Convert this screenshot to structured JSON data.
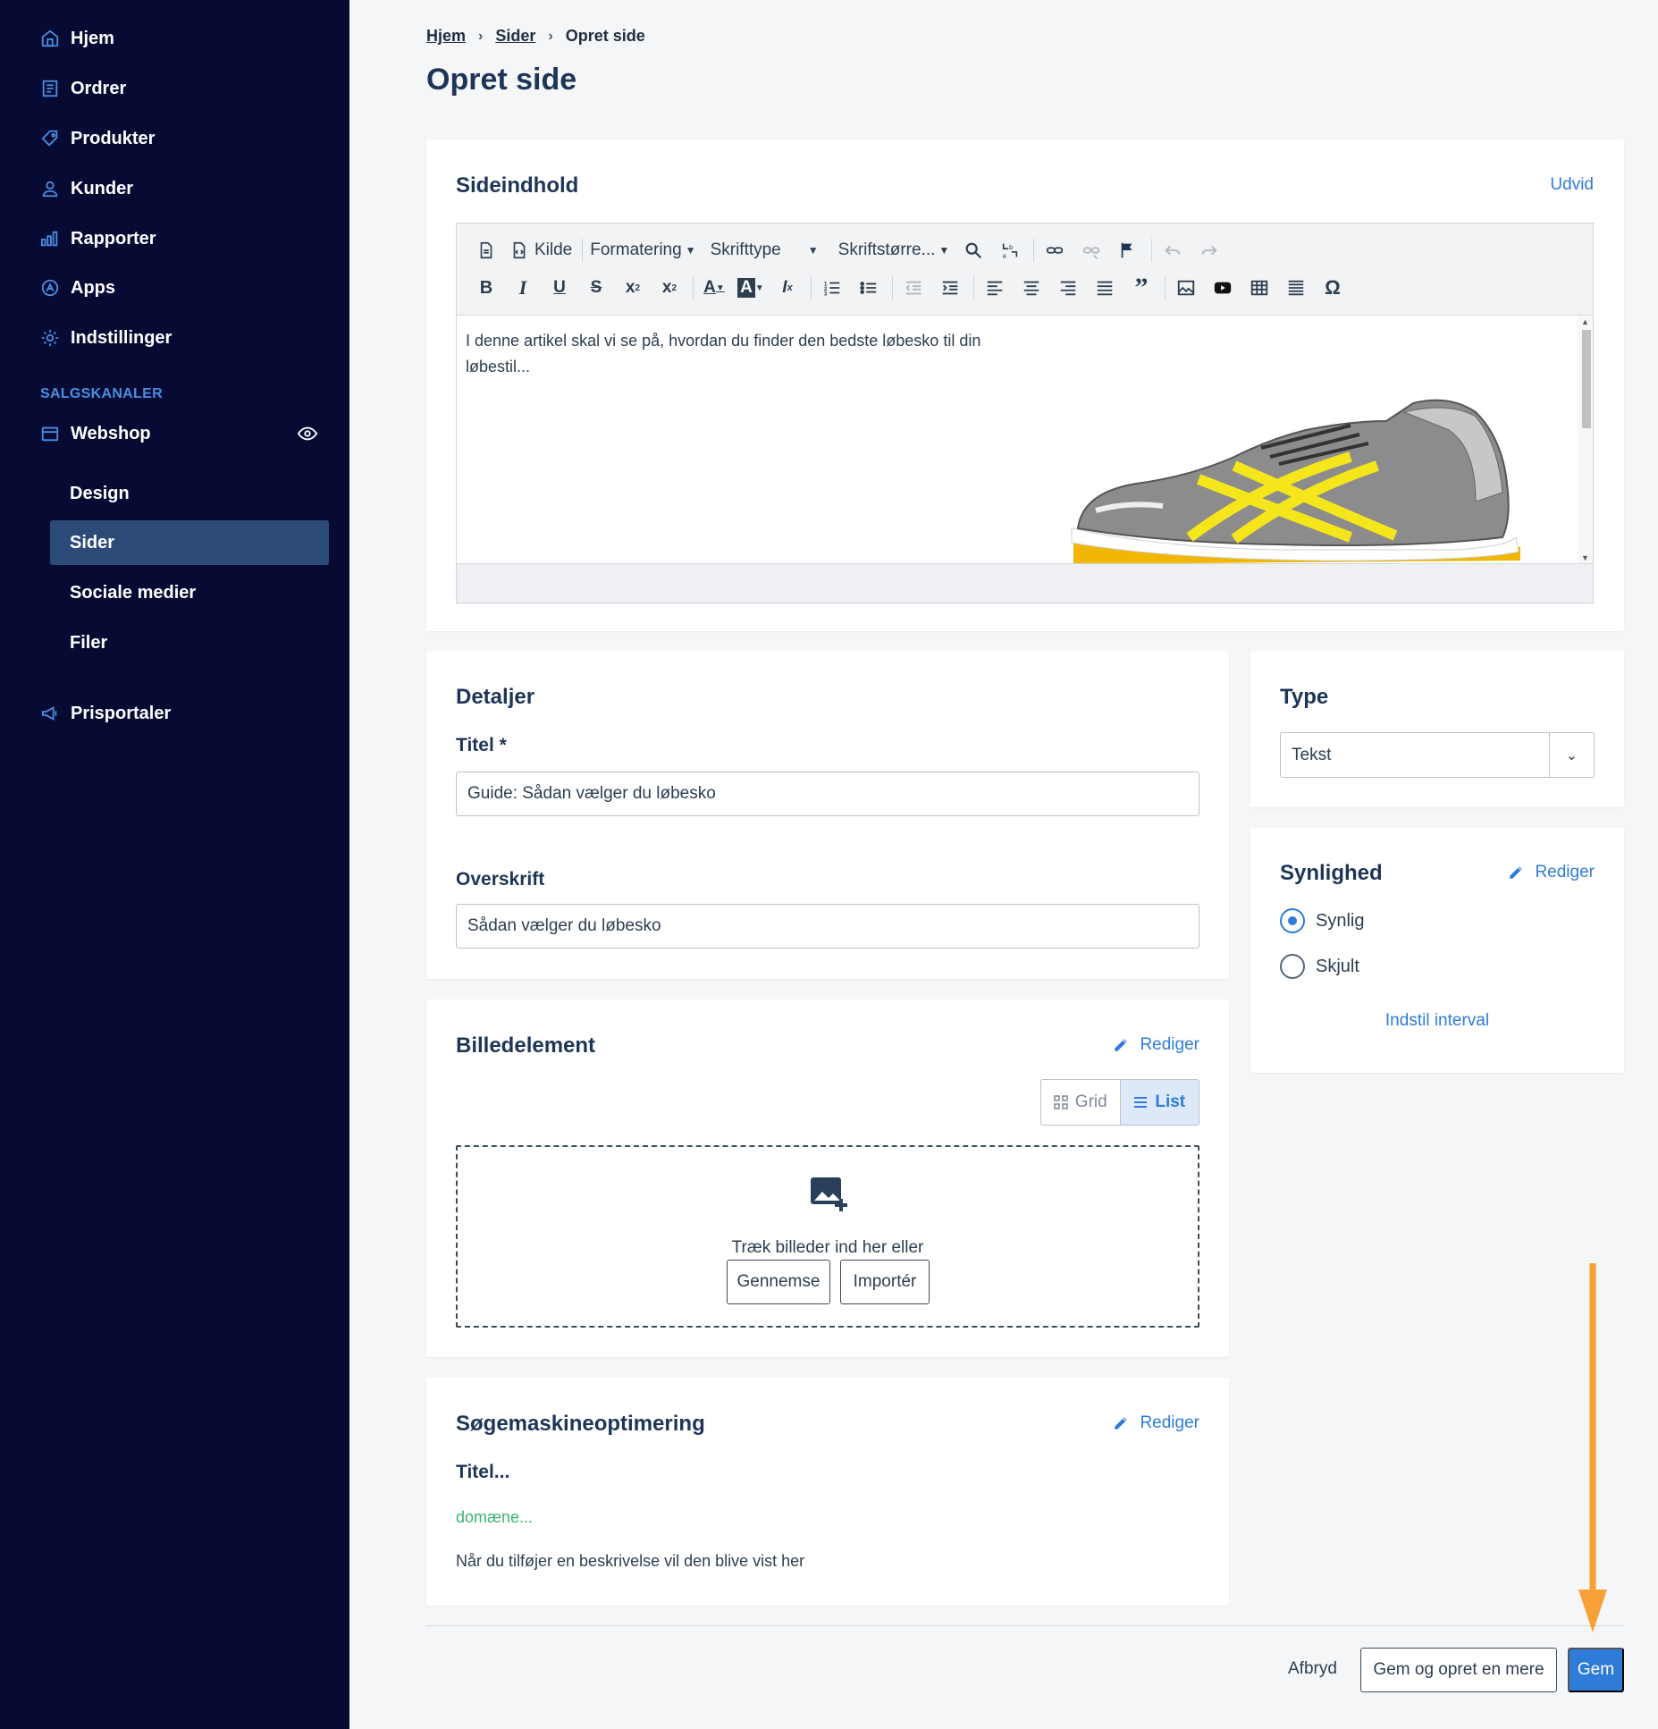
{
  "sidebar": {
    "items": [
      {
        "label": "Hjem",
        "icon": "home-icon"
      },
      {
        "label": "Ordrer",
        "icon": "orders-icon"
      },
      {
        "label": "Produkter",
        "icon": "tag-icon"
      },
      {
        "label": "Kunder",
        "icon": "user-icon"
      },
      {
        "label": "Rapporter",
        "icon": "bar-chart-icon"
      },
      {
        "label": "Apps",
        "icon": "apps-icon"
      },
      {
        "label": "Indstillinger",
        "icon": "gear-icon"
      }
    ],
    "section_label": "SALGSKANALER",
    "webshop": {
      "label": "Webshop",
      "icon": "store-icon",
      "visibility_icon": "eye-icon"
    },
    "sub_items": [
      {
        "label": "Design",
        "active": false
      },
      {
        "label": "Sider",
        "active": true
      },
      {
        "label": "Sociale medier",
        "active": false
      },
      {
        "label": "Filer",
        "active": false
      }
    ],
    "prisportaler": {
      "label": "Prisportaler",
      "icon": "megaphone-icon"
    }
  },
  "breadcrumb": {
    "items": [
      "Hjem",
      "Sider"
    ],
    "current": "Opret side"
  },
  "page_title": "Opret side",
  "content_card": {
    "title": "Sideindhold",
    "expand_label": "Udvid",
    "toolbar": {
      "source_label": "Kilde",
      "format_label": "Formatering",
      "font_label": "Skrifttype",
      "size_label": "Skriftstørre..."
    },
    "body_text": "I denne artikel skal vi se på, hvordan du finder den bedste løbesko til din løbestil...",
    "image": "running-shoe-image"
  },
  "details_card": {
    "title": "Detaljer",
    "title_label": "Titel *",
    "title_value": "Guide: Sådan vælger du løbesko",
    "heading_label": "Overskrift",
    "heading_value": "Sådan vælger du løbesko"
  },
  "image_card": {
    "title": "Billedelement",
    "edit_label": "Rediger",
    "view_grid": "Grid",
    "view_list": "List",
    "drop_text": "Træk billeder ind her eller",
    "browse_label": "Gennemse",
    "import_label": "Importér"
  },
  "seo_card": {
    "title": "Søgemaskineoptimering",
    "edit_label": "Rediger",
    "preview_title": "Titel...",
    "preview_domain": "domæne...",
    "preview_desc": "Når du tilføjer en beskrivelse vil den blive vist her"
  },
  "type_card": {
    "title": "Type",
    "selected": "Tekst"
  },
  "visibility_card": {
    "title": "Synlighed",
    "edit_label": "Rediger",
    "options": [
      {
        "label": "Synlig",
        "checked": true
      },
      {
        "label": "Skjult",
        "checked": false
      }
    ],
    "interval_label": "Indstil interval"
  },
  "footer": {
    "cancel_label": "Afbryd",
    "save_more_label": "Gem og opret en mere",
    "save_label": "Gem"
  },
  "colors": {
    "sidebar_bg": "#070b34",
    "accent": "#2e7bd8",
    "active_bg": "#2b4a78",
    "annotation_arrow": "#f7a035",
    "domain_green": "#3cb371"
  }
}
